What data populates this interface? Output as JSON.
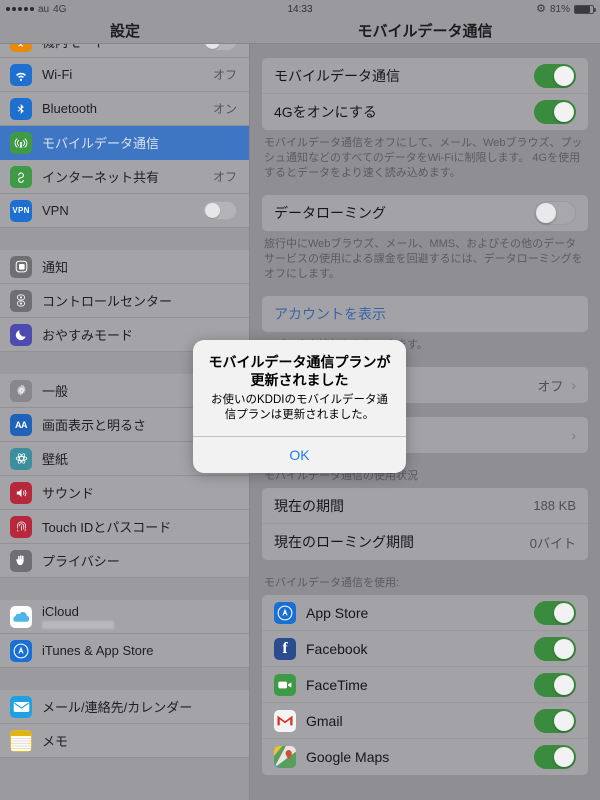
{
  "statusbar": {
    "carrier": "au",
    "network": "4G",
    "time": "14:33",
    "bluetooth_icon": "bluetooth-icon",
    "battery_percent": "81%",
    "battery_level": 81
  },
  "navbars": {
    "sidebar_title": "設定",
    "main_title": "モバイルデータ通信"
  },
  "sidebar": {
    "groups": [
      {
        "partial_top": {
          "label": "機内モード",
          "icon": "airplane-icon",
          "icon_color": "#e8890c"
        },
        "items": [
          {
            "label": "Wi-Fi",
            "value": "オフ",
            "icon": "wifi-icon",
            "icon_color": "#1d6fd0",
            "control": "value"
          },
          {
            "label": "Bluetooth",
            "value": "オン",
            "icon": "bluetooth-icon",
            "icon_color": "#1d6fd0",
            "control": "value"
          },
          {
            "label": "モバイルデータ通信",
            "value": "",
            "icon": "cellular-icon",
            "icon_color": "#3f9a46",
            "control": "none",
            "selected": true
          },
          {
            "label": "インターネット共有",
            "value": "オフ",
            "icon": "hotspot-icon",
            "icon_color": "#3f9a46",
            "control": "value"
          },
          {
            "label": "VPN",
            "value": "",
            "icon": "vpn-icon",
            "icon_color": "#1d6fd0",
            "control": "switch",
            "switch_on": false
          }
        ]
      },
      {
        "items": [
          {
            "label": "通知",
            "value": "",
            "icon": "notifications-icon",
            "icon_color": "#6e6e73",
            "control": "none"
          },
          {
            "label": "コントロールセンター",
            "value": "",
            "icon": "control-center-icon",
            "icon_color": "#6e6e73",
            "control": "none"
          },
          {
            "label": "おやすみモード",
            "value": "",
            "icon": "moon-icon",
            "icon_color": "#4c4cb0",
            "control": "none"
          }
        ]
      },
      {
        "items": [
          {
            "label": "一般",
            "value": "",
            "icon": "gear-icon",
            "icon_color": "#87878c",
            "control": "none"
          },
          {
            "label": "画面表示と明るさ",
            "value": "",
            "icon": "display-icon",
            "icon_color": "#1f63b8",
            "control": "none"
          },
          {
            "label": "壁紙",
            "value": "",
            "icon": "wallpaper-icon",
            "icon_color": "#3d8fa0",
            "control": "none"
          },
          {
            "label": "サウンド",
            "value": "",
            "icon": "sound-icon",
            "icon_color": "#b8283c",
            "control": "none"
          },
          {
            "label": "Touch IDとパスコード",
            "value": "",
            "icon": "fingerprint-icon",
            "icon_color": "#b8283c",
            "control": "none"
          },
          {
            "label": "プライバシー",
            "value": "",
            "icon": "privacy-hand-icon",
            "icon_color": "#6e6e73",
            "control": "none"
          }
        ]
      },
      {
        "items": [
          {
            "label": "iCloud",
            "value": "",
            "icon": "icloud-icon",
            "icon_color": "#ffffff",
            "control": "none",
            "redacted_subtitle": true
          },
          {
            "label": "iTunes & App Store",
            "value": "",
            "icon": "appstore-icon",
            "icon_color": "#1a6fd4",
            "control": "none"
          }
        ]
      },
      {
        "items": [
          {
            "label": "メール/連絡先/カレンダー",
            "value": "",
            "icon": "mail-icon",
            "icon_color": "#1da1e2",
            "control": "none"
          },
          {
            "label": "メモ",
            "value": "",
            "icon": "notes-icon",
            "icon_color": "#e6b81f",
            "control": "none"
          }
        ]
      }
    ]
  },
  "main": {
    "section1": {
      "rows": [
        {
          "label": "モバイルデータ通信",
          "control": "switch",
          "switch_on": true
        },
        {
          "label": "4Gをオンにする",
          "control": "switch",
          "switch_on": true
        }
      ],
      "footnote": "モバイルデータ通信をオフにして、メール、Webブラウズ、プッシュ通知などのすべてのデータをWi-Fiに制限します。 4Gを使用するとデータをより速く読み込めます。"
    },
    "section2": {
      "rows": [
        {
          "label": "データローミング",
          "control": "switch",
          "switch_on": false
        }
      ],
      "footnote": "旅行中にWebブラウズ、メール、MMS、およびその他のデータサービスの使用による課金を回避するには、データローミングをオフにします。"
    },
    "section3": {
      "rows": [
        {
          "label": "アカウントを表示",
          "control": "none",
          "link": true
        }
      ],
      "footnote": "、データを追加したりできます。"
    },
    "section4": {
      "rows": [
        {
          "label": "",
          "value": "オフ",
          "control": "chevron"
        }
      ]
    },
    "section5": {
      "rows": [
        {
          "label": "",
          "value": "",
          "control": "chevron"
        }
      ]
    },
    "usage": {
      "header": "モバイルデータ通信の使用状況",
      "rows": [
        {
          "label": "現在の期間",
          "value": "188 KB"
        },
        {
          "label": "現在のローミング期間",
          "value": "0バイト"
        }
      ]
    },
    "apps": {
      "header": "モバイルデータ通信を使用:",
      "rows": [
        {
          "label": "App Store",
          "icon": "appstore-icon",
          "icon_color": "#1a6fd4",
          "switch_on": true
        },
        {
          "label": "Facebook",
          "icon": "facebook-icon",
          "icon_color": "#2a4b8d",
          "switch_on": true
        },
        {
          "label": "FaceTime",
          "icon": "facetime-icon",
          "icon_color": "#3f9a46",
          "switch_on": true
        },
        {
          "label": "Gmail",
          "icon": "gmail-icon",
          "icon_color": "#f4f4f4",
          "switch_on": true
        },
        {
          "label": "Google Maps",
          "icon": "googlemaps-icon",
          "icon_color": "#5a9e5e",
          "switch_on": true
        }
      ]
    }
  },
  "alert": {
    "title_line1": "モバイルデータ通信プランが",
    "title_line2": "更新されました",
    "message": "お使いのKDDIのモバイルデータ通信プランは更新されました。",
    "ok_label": "OK",
    "accent_color": "#1a7df0"
  }
}
